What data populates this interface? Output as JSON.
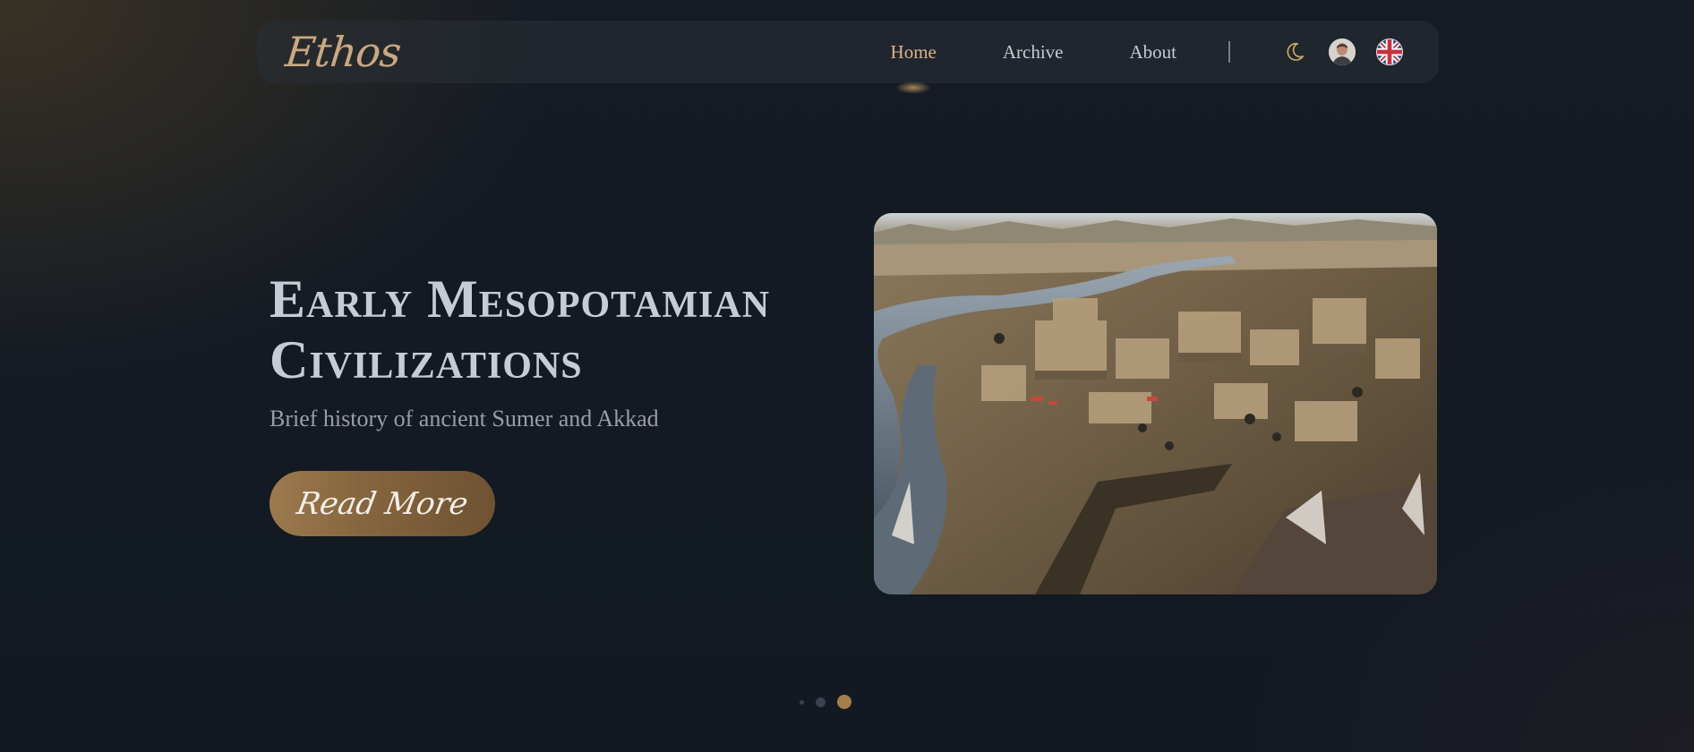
{
  "brand": {
    "logo_text": "Ethos"
  },
  "nav": {
    "items": [
      {
        "label": "Home",
        "active": true
      },
      {
        "label": "Archive",
        "active": false
      },
      {
        "label": "About",
        "active": false
      }
    ],
    "icons": [
      "moon-icon",
      "user-avatar",
      "uk-flag-icon"
    ]
  },
  "hero": {
    "title_line1": "Early Mesopotamian",
    "title_line2": "Civilizations",
    "subtitle": "Brief history of ancient Sumer and Akkad",
    "cta_label": "Read More",
    "image_alt": "Illustration of an ancient Mesopotamian city by a river"
  },
  "carousel": {
    "slides": 3,
    "active_index": 2
  },
  "colors": {
    "accent": "#d8b48a",
    "button": "#8a6a42",
    "background": "#121921",
    "text": "#c7ccd4"
  }
}
